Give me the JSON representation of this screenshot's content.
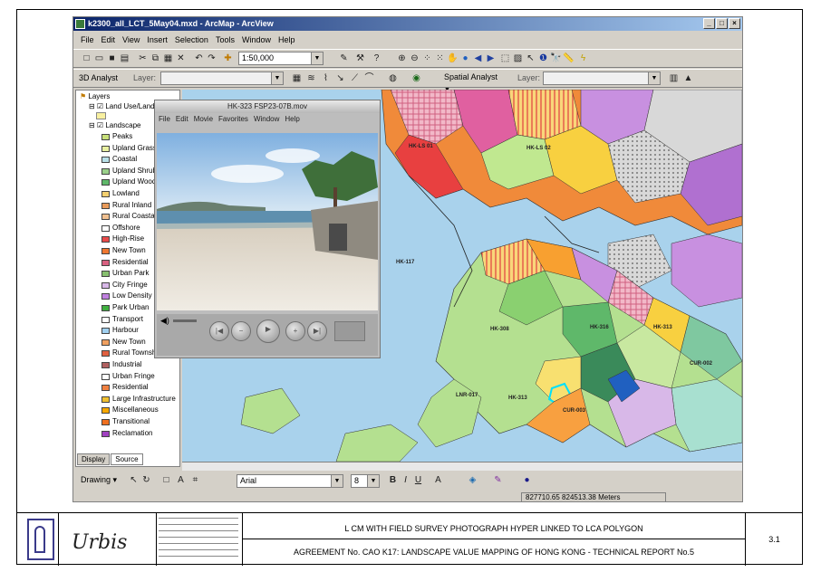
{
  "window": {
    "title": "k2300_all_LCT_5May04.mxd - ArcMap - ArcView",
    "menu": [
      "File",
      "Edit",
      "View",
      "Insert",
      "Selection",
      "Tools",
      "Window",
      "Help"
    ],
    "scale": "1:50,000",
    "editor_label": "3D Analyst",
    "layer_label": "Layer:",
    "spatial_analyst_label": "Spatial Analyst",
    "layer_label2": "Layer:",
    "drawing_label": "Drawing",
    "font_name": "Arial",
    "font_size": "8",
    "status_coords": "827710.65 824513.38 Meters"
  },
  "toc": {
    "root": "Layers",
    "groups": [
      "Land Use/Land Cover",
      "Landscape"
    ],
    "items": [
      {
        "label": "Peaks",
        "color": "#c8e07a"
      },
      {
        "label": "Upland Grassland",
        "color": "#e8f0a0"
      },
      {
        "label": "Coastal",
        "color": "#b8e0e8"
      },
      {
        "label": "Upland Shrubland",
        "color": "#9ad08a"
      },
      {
        "label": "Upland Wooded",
        "color": "#5fb86a"
      },
      {
        "label": "Lowland",
        "color": "#f4d070"
      },
      {
        "label": "Rural Inland",
        "color": "#e89a5a"
      },
      {
        "label": "Rural Coastal",
        "color": "#f0c090"
      },
      {
        "label": "Offshore",
        "color": "#ffffff"
      },
      {
        "label": "High-Rise",
        "color": "#e84a4a"
      },
      {
        "label": "New Town",
        "color": "#f07830"
      },
      {
        "label": "Residential",
        "color": "#d86080"
      },
      {
        "label": "Urban Park",
        "color": "#88c070"
      },
      {
        "label": "City Fringe",
        "color": "#d8b8e8"
      },
      {
        "label": "Low Density",
        "color": "#c080e0"
      },
      {
        "label": "Park Urban",
        "color": "#40b040"
      },
      {
        "label": "Transport",
        "color": "#ffffff"
      },
      {
        "label": "Harbour",
        "color": "#a0d0f0"
      },
      {
        "label": "New Town",
        "color": "#f0a060"
      },
      {
        "label": "Rural Township",
        "color": "#e06040"
      },
      {
        "label": "Industrial",
        "color": "#b06060"
      },
      {
        "label": "Urban Fringe",
        "color": "#ffffff"
      },
      {
        "label": "Residential",
        "color": "#f08040"
      },
      {
        "label": "Large Infrastructure",
        "color": "#f0c030"
      },
      {
        "label": "Miscellaneous",
        "color": "#f8a800"
      },
      {
        "label": "Transitional",
        "color": "#f07020"
      },
      {
        "label": "Reclamation",
        "color": "#a040c0"
      }
    ],
    "tab_display": "Display",
    "tab_source": "Source"
  },
  "map_labels": [
    "HK-LS 01",
    "HK-LS 02",
    "HK-117",
    "HK-308",
    "HK-316",
    "HK-313",
    "LNR-017",
    "CUR-002",
    "HK-313",
    "CUR-003"
  ],
  "player": {
    "title": "HK-323 FSP23-07B.mov",
    "menu": [
      "File",
      "Edit",
      "Movie",
      "Favorites",
      "Window",
      "Help"
    ]
  },
  "footer": {
    "title1": "L CM WITH FIELD SURVEY PHOTOGRAPH HYPER LINKED TO LCA POLYGON",
    "title2": "AGREEMENT No. CAO K17: LANDSCAPE VALUE MAPPING OF HONG KONG - TECHNICAL REPORT No.5",
    "fig_no": "3.1",
    "brand": "Urbis"
  }
}
